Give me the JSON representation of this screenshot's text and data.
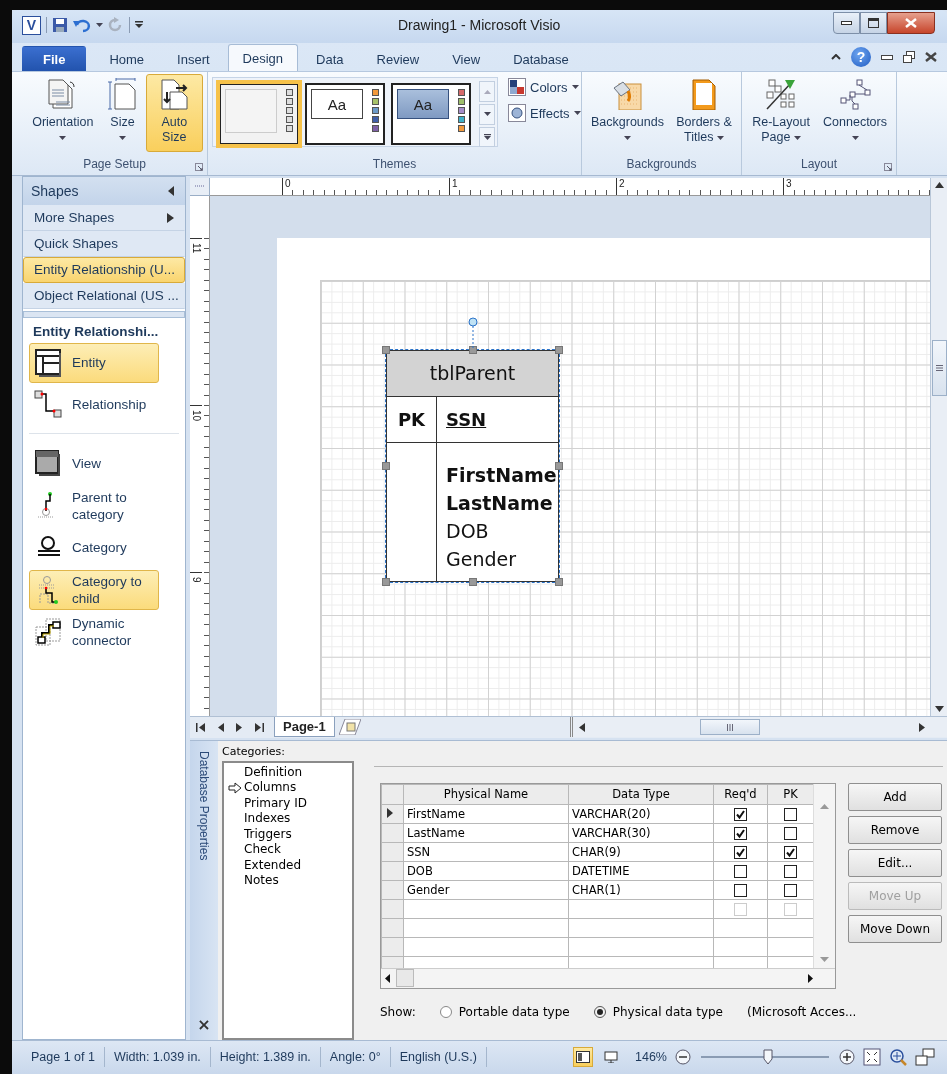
{
  "window": {
    "app_icon": "V",
    "title": "Drawing1  -  Microsoft Visio"
  },
  "ribbon_tabs": [
    {
      "label": "File",
      "kind": "file",
      "selected": false
    },
    {
      "label": "Home",
      "kind": "tab",
      "selected": false
    },
    {
      "label": "Insert",
      "kind": "tab",
      "selected": false
    },
    {
      "label": "Design",
      "kind": "tab",
      "selected": true
    },
    {
      "label": "Data",
      "kind": "tab",
      "selected": false
    },
    {
      "label": "Review",
      "kind": "tab",
      "selected": false
    },
    {
      "label": "View",
      "kind": "tab",
      "selected": false
    },
    {
      "label": "Database",
      "kind": "tab",
      "selected": false
    }
  ],
  "ribbon_help": "?",
  "ribbon_groups": [
    {
      "label": "Page Setup",
      "kind": "buttons",
      "launcher": true,
      "buttons": [
        {
          "label": "Orientation",
          "dropdown": true,
          "selected": false
        },
        {
          "label": "Size",
          "dropdown": true,
          "selected": false
        },
        {
          "label": "Auto Size",
          "dropdown": false,
          "selected": true
        }
      ]
    },
    {
      "label": "Themes",
      "kind": "themes",
      "launcher": false,
      "themes": [
        {
          "kind": "blank",
          "selected": true
        },
        {
          "kind": "plain",
          "text": "Aa",
          "selected": false
        },
        {
          "kind": "shaded",
          "text": "Aa",
          "selected": false
        }
      ],
      "options": [
        {
          "label": "Colors"
        },
        {
          "label": "Effects"
        }
      ]
    },
    {
      "label": "Backgrounds",
      "kind": "buttons",
      "launcher": false,
      "buttons": [
        {
          "label": "Backgrounds",
          "dropdown": true,
          "selected": false
        },
        {
          "label": "Borders & Titles",
          "dropdown": true,
          "selected": false
        }
      ]
    },
    {
      "label": "Layout",
      "kind": "buttons",
      "launcher": true,
      "buttons": [
        {
          "label": "Re-Layout Page",
          "dropdown": true,
          "selected": false
        },
        {
          "label": "Connectors",
          "dropdown": true,
          "selected": false
        }
      ]
    }
  ],
  "shapes_panel": {
    "title": "Shapes",
    "more": "More Shapes",
    "stencils": [
      {
        "label": "Quick Shapes",
        "selected": false
      },
      {
        "label": "Entity Relationship (U...",
        "selected": true
      },
      {
        "label": "Object Relational (US ...",
        "selected": false
      }
    ],
    "stencil_title": "Entity Relationshi...",
    "item_groups": [
      [
        {
          "label": "Entity",
          "selected": true
        },
        {
          "label": "Relationship",
          "selected": false
        }
      ],
      [
        {
          "label": "View",
          "selected": false
        },
        {
          "label": "Parent to category",
          "selected": false
        },
        {
          "label": "Category",
          "selected": false
        },
        {
          "label": "Category to child",
          "selected": true
        },
        {
          "label": "Dynamic connector",
          "selected": false
        }
      ]
    ]
  },
  "ruler": {
    "x_labels": [
      "0",
      "1",
      "2",
      "3"
    ],
    "y_labels": [
      "11",
      "10",
      "9"
    ]
  },
  "entity": {
    "name": "tblParent",
    "pk_label": "PK",
    "primary_key": "SSN",
    "selected": true,
    "attributes": [
      {
        "text": "FirstName",
        "required": true
      },
      {
        "text": "LastName",
        "required": true
      },
      {
        "text": "DOB",
        "required": false
      },
      {
        "text": "Gender",
        "required": false
      }
    ]
  },
  "page_tabs": [
    {
      "label": "Page-1",
      "selected": true
    }
  ],
  "properties": {
    "title": "Database Properties",
    "close": "×",
    "categories_label": "Categories:",
    "categories": [
      {
        "label": "Definition",
        "selected": false
      },
      {
        "label": "Columns",
        "selected": true
      },
      {
        "label": "Primary ID",
        "selected": false
      },
      {
        "label": "Indexes",
        "selected": false
      },
      {
        "label": "Triggers",
        "selected": false
      },
      {
        "label": "Check",
        "selected": false
      },
      {
        "label": "Extended",
        "selected": false
      },
      {
        "label": "Notes",
        "selected": false
      }
    ],
    "columns": [
      "Physical Name",
      "Data Type",
      "Req'd",
      "PK"
    ],
    "rows": [
      {
        "name": "FirstName",
        "type": "VARCHAR(20)",
        "required": true,
        "pk": false,
        "current": true
      },
      {
        "name": "LastName",
        "type": "VARCHAR(30)",
        "required": true,
        "pk": false,
        "current": false
      },
      {
        "name": "SSN",
        "type": "CHAR(9)",
        "required": true,
        "pk": true,
        "current": false
      },
      {
        "name": "DOB",
        "type": "DATETIME",
        "required": false,
        "pk": false,
        "current": false
      },
      {
        "name": "Gender",
        "type": "CHAR(1)",
        "required": false,
        "pk": false,
        "current": false
      }
    ],
    "new_row": {
      "required": false,
      "pk": false,
      "disabled": true
    },
    "buttons": [
      {
        "label": "Add",
        "disabled": false
      },
      {
        "label": "Remove",
        "disabled": false
      },
      {
        "label": "Edit...",
        "disabled": false
      },
      {
        "label": "Move Up",
        "disabled": true
      },
      {
        "label": "Move Down",
        "disabled": false
      }
    ],
    "show_label": "Show:",
    "show_options": [
      {
        "label": "Portable data type",
        "selected": false
      },
      {
        "label": "Physical data type",
        "selected": true
      }
    ],
    "target": "(Microsoft Acces..."
  },
  "status": {
    "items": [
      "Page 1 of 1",
      "Width: 1.039 in.",
      "Height: 1.389 in.",
      "Angle: 0°",
      "English (U.S.)"
    ],
    "views": [
      {
        "selected": true
      },
      {
        "selected": false
      }
    ],
    "zoom": "146%",
    "zoom_slider": {
      "level": 0.52
    }
  }
}
